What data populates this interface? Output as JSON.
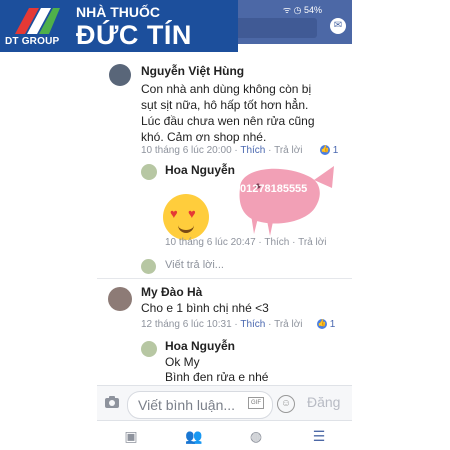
{
  "brand": {
    "group": "DT GROUP",
    "top_line": "NHÀ THUỐC",
    "main_line": "ĐỨC TÍN",
    "color": "#1c4f9c"
  },
  "status": {
    "battery": "54%"
  },
  "comments": [
    {
      "name": "Nguyễn Việt Hùng",
      "lines": [
        "Con nhà anh dùng không còn bị",
        "sụt sịt nữa, hô hấp tốt hơn hẳn.",
        "Lúc đầu chưa wen nên rửa cũng",
        "khó. Cảm ơn shop nhé."
      ],
      "time": "10 tháng 6 lúc 20:00",
      "like": "Thích",
      "reply": "Trả lời",
      "reactions": "1",
      "reply_thread": {
        "name": "Hoa Nguyễn",
        "sticker_phone": "01278185555",
        "time": "10 tháng 6 lúc 20:47",
        "like": "Thích",
        "reply": "Trả lời"
      },
      "reply_placeholder": "Viết trả lời..."
    },
    {
      "name": "My Đào Hà",
      "lines": [
        "Cho e 1 bình chị nhé <3"
      ],
      "time": "12 tháng 6 lúc 10:31",
      "like": "Thích",
      "reply": "Trả lời",
      "reactions": "1",
      "reply_thread": {
        "name": "Hoa Nguyễn",
        "lines": [
          "Ok My",
          "Bình đen rửa e nhé"
        ]
      }
    }
  ],
  "composer": {
    "placeholder": "Viết bình luận...",
    "gif_label": "GIF",
    "post_label": "Đăng"
  },
  "nav": [
    "news-feed",
    "friends",
    "globe",
    "menu"
  ],
  "colors": {
    "accent": "#4c68a6",
    "link": "#4a68b0",
    "meta": "#8e939d"
  }
}
